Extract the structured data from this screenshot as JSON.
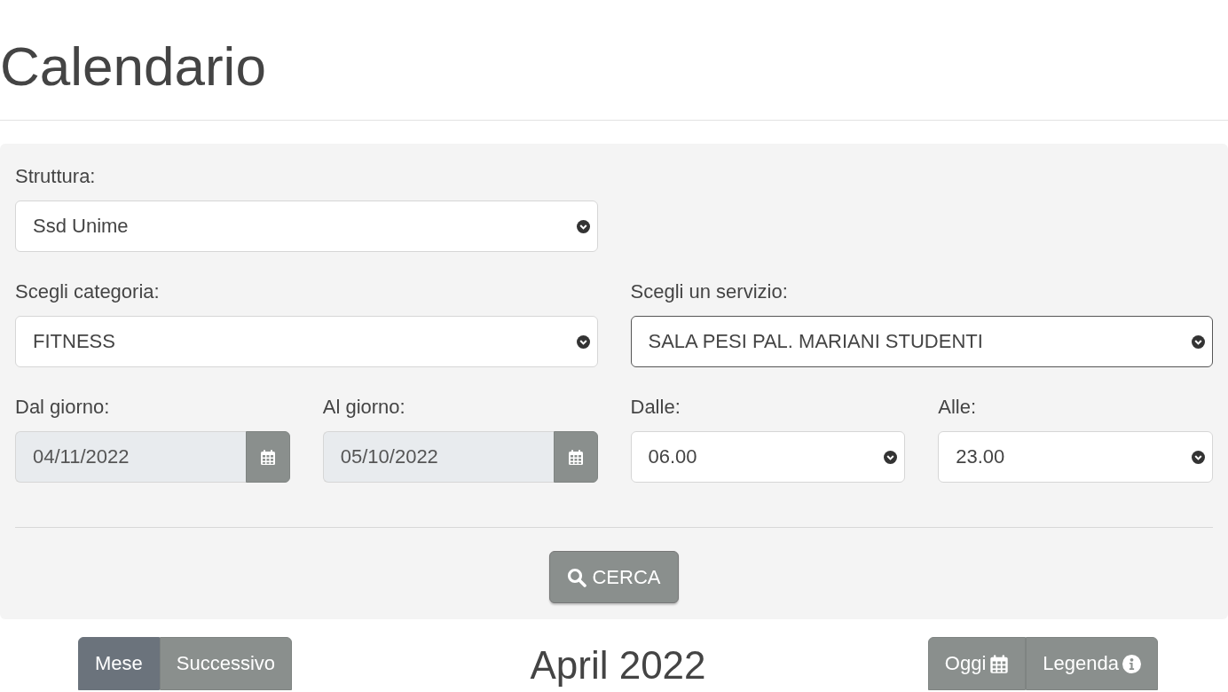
{
  "page_title": "Calendario",
  "filters": {
    "fields": [
      {
        "kind": "select",
        "label": "Struttura:",
        "value": "Ssd Unime",
        "focused": false
      },
      {
        "kind": "select",
        "label": "Scegli categoria:",
        "value": "FITNESS",
        "focused": false
      },
      {
        "kind": "select",
        "label": "Scegli un servizio:",
        "value": "SALA PESI PAL. MARIANI STUDENTI",
        "focused": true
      },
      {
        "kind": "date",
        "label": "Dal giorno:",
        "value": "04/11/2022",
        "disabled": true
      },
      {
        "kind": "date",
        "label": "Al giorno:",
        "value": "05/10/2022",
        "disabled": true
      },
      {
        "kind": "select",
        "label": "Dalle:",
        "value": "06.00",
        "focused": false
      },
      {
        "kind": "select",
        "label": "Alle:",
        "value": "23.00",
        "focused": false
      }
    ],
    "search_button": "CERCA"
  },
  "calendar": {
    "view_buttons": [
      {
        "label": "Mese",
        "selected": true
      },
      {
        "label": "Successivo",
        "selected": false
      }
    ],
    "title": "April 2022",
    "action_buttons": [
      {
        "label": "Oggi",
        "kind": "today"
      },
      {
        "label": "Legenda",
        "kind": "legend"
      }
    ]
  }
}
